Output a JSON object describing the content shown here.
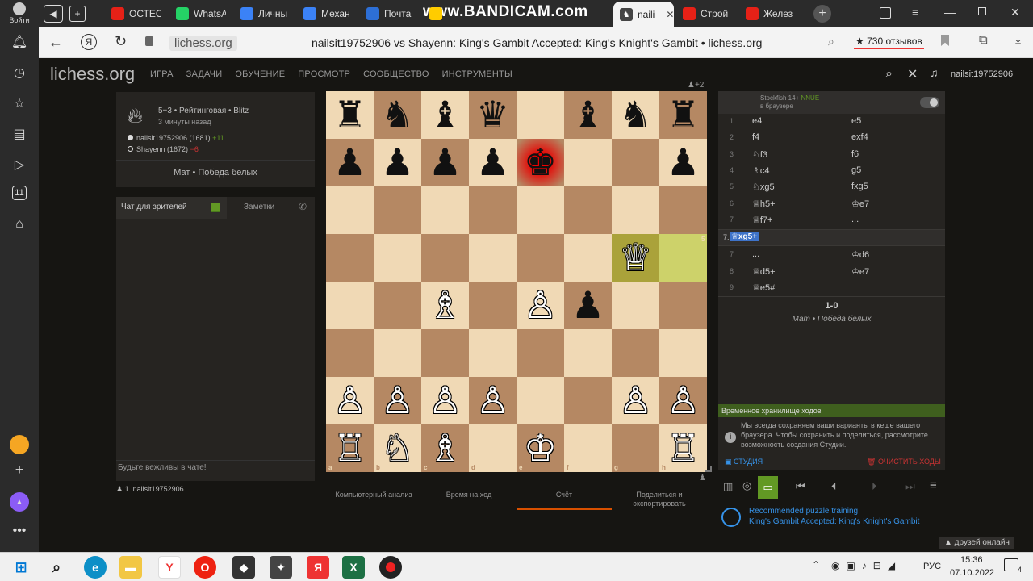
{
  "browser": {
    "tabs": [
      {
        "label": "ОСТЕО",
        "color": "#e62117"
      },
      {
        "label": "WhatsA",
        "color": "#25d366"
      },
      {
        "label": "Личны",
        "color": "#3b82f6"
      },
      {
        "label": "Механ",
        "color": "#3b82f6"
      },
      {
        "label": "Почта",
        "color": "#2d6fd6"
      },
      {
        "label": "",
        "color": "#ffcc00"
      }
    ],
    "active_tab": "naili",
    "tabs_after": [
      {
        "label": "Строй",
        "color": "#e62117"
      },
      {
        "label": "Желез",
        "color": "#e62117"
      }
    ],
    "watermark": "www.BANDICAM.com",
    "login": "Войти",
    "url": "lichess.org",
    "page_title": "nailsit19752906 vs Shayenn: King's Gambit Accepted: King's Knight's Gambit • lichess.org",
    "reviews": "★ 730 отзывов"
  },
  "site": {
    "logo": "lichess.org",
    "nav": [
      "ИГРА",
      "ЗАДАЧИ",
      "ОБУЧЕНИЕ",
      "ПРОСМОТР",
      "СООБЩЕСТВО",
      "ИНСТРУМЕНТЫ"
    ],
    "username": "nailsit19752906",
    "viewers": "+2"
  },
  "game": {
    "type": "5+3 • Рейтинговая • Blitz",
    "time_ago": "3 минуты назад",
    "white": "nailsit19752906 (1681)",
    "white_diff": "+11",
    "black": "Shayenn (1672)",
    "black_diff": "−6",
    "result_text": "Мат • Победа белых"
  },
  "chat": {
    "tab_chat": "Чат для зрителей",
    "tab_notes": "Заметки",
    "placeholder": "Будьте вежливы в чате!",
    "spectators": "1",
    "spectator_name": "nailsit19752906"
  },
  "board_tabs": [
    "Компьютерный анализ",
    "Время на ход",
    "Счёт",
    "Поделиться и экспортировать"
  ],
  "engine": {
    "name": "Stockfish 14+",
    "badge": "NNUE",
    "sub": "в браузере"
  },
  "moves": [
    {
      "n": "1",
      "w": "e4",
      "b": "e5"
    },
    {
      "n": "2",
      "w": "f4",
      "b": "exf4"
    },
    {
      "n": "3",
      "w": "♘f3",
      "b": "f6"
    },
    {
      "n": "4",
      "w": "♗c4",
      "b": "g5"
    },
    {
      "n": "5",
      "w": "♘xg5",
      "b": "fxg5"
    },
    {
      "n": "6",
      "w": "♕h5+",
      "b": "♔e7"
    },
    {
      "n": "7",
      "w": "♕f7+",
      "b": "..."
    }
  ],
  "variation": {
    "label": "7.",
    "move": "♕xg5+"
  },
  "moves2": [
    {
      "n": "7",
      "w": "...",
      "b": "♔d6"
    },
    {
      "n": "8",
      "w": "♕d5+",
      "b": "♔e7"
    },
    {
      "n": "9",
      "w": "♕e5#",
      "b": ""
    }
  ],
  "result": {
    "score": "1-0",
    "text": "Мат • Победа белых"
  },
  "storage": {
    "title": "Временное хранилище ходов",
    "text": "Мы всегда сохраняем ваши варианты в кеше вашего браузера. Чтобы сохранить и поделиться, рассмотрите возможность создания Студии.",
    "studio": "СТУДИЯ",
    "clear": "ОЧИСТИТЬ ХОДЫ"
  },
  "puzzle": {
    "title": "Recommended puzzle training",
    "sub": "King's Gambit Accepted: King's Knight's Gambit"
  },
  "friends": "▲ друзей онлайн",
  "taskbar": {
    "lang": "РУС",
    "time": "15:36",
    "date": "07.10.2022",
    "notif": "4"
  },
  "board": {
    "files": [
      "a",
      "b",
      "c",
      "d",
      "e",
      "f",
      "g",
      "h"
    ],
    "ranks": [
      "8",
      "7",
      "6",
      "5",
      "4",
      "3",
      "2",
      "1"
    ],
    "pieces": [
      [
        "♜",
        "♞",
        "♝",
        "♛",
        "",
        "♝",
        "♞",
        "♜"
      ],
      [
        "♟",
        "♟",
        "♟",
        "♟",
        "♚",
        "",
        "",
        "♟"
      ],
      [
        "",
        "",
        "",
        "",
        "",
        "",
        "",
        ""
      ],
      [
        "",
        "",
        "",
        "",
        "",
        "",
        "♕",
        ""
      ],
      [
        "",
        "",
        "♗",
        "",
        "♙",
        "♟",
        "",
        ""
      ],
      [
        "",
        "",
        "",
        "",
        "",
        "",
        "",
        ""
      ],
      [
        "♙",
        "♙",
        "♙",
        "♙",
        "",
        "",
        "♙",
        "♙"
      ],
      [
        "♖",
        "♘",
        "♗",
        "",
        "♔",
        "",
        "",
        "♖"
      ]
    ],
    "last_move": [
      "g5",
      "h5"
    ],
    "check": "e7"
  }
}
